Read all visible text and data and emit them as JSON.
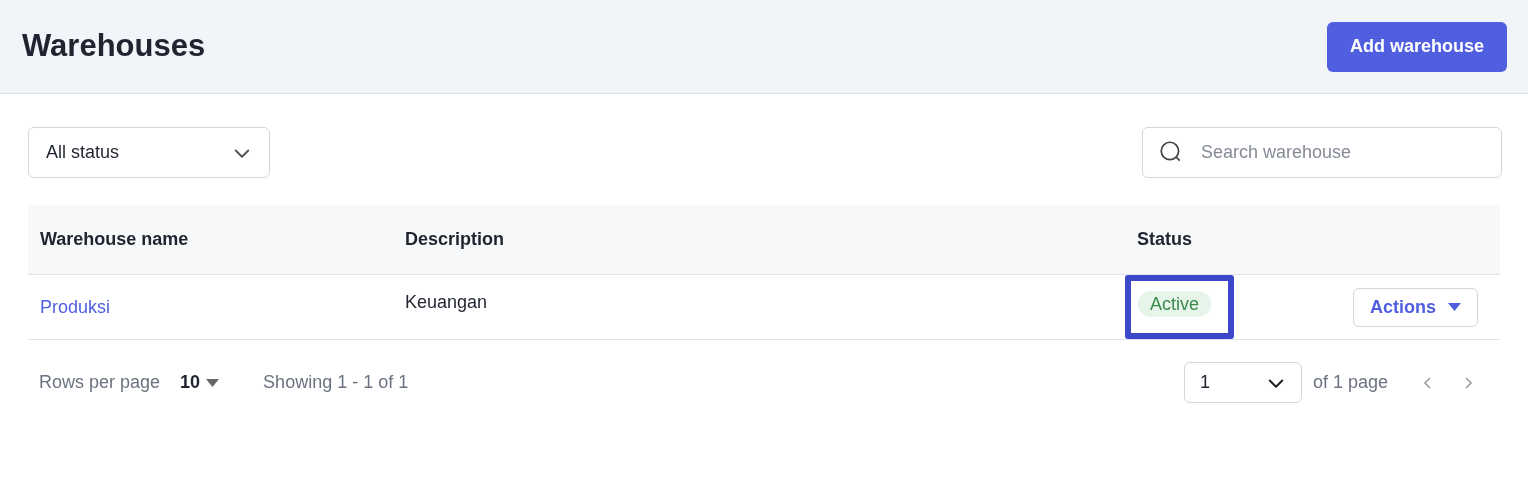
{
  "header": {
    "title": "Warehouses",
    "add_button": "Add warehouse"
  },
  "filters": {
    "status_select": "All status",
    "search": {
      "placeholder": "Search warehouse"
    }
  },
  "table": {
    "columns": [
      "Warehouse name",
      "Description",
      "Status"
    ],
    "rows": [
      {
        "name": "Produksi",
        "description": "Keuangan",
        "status": "Active",
        "highlighted": true,
        "actions": "Actions"
      }
    ]
  },
  "pagination": {
    "rows_per_page_label": "Rows per page",
    "rows_per_page": "10",
    "showing": "Showing 1 - 1 of 1",
    "page": "1",
    "of_pages": "of 1 page"
  }
}
